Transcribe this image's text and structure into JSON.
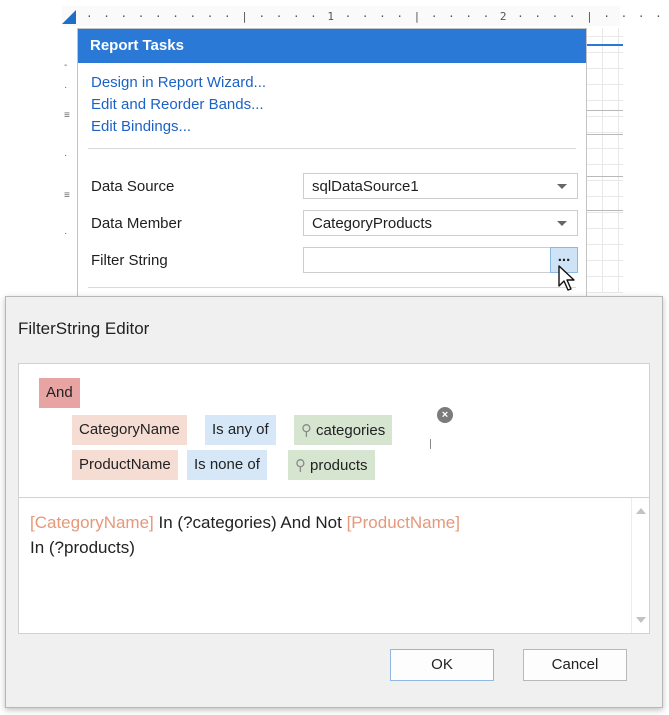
{
  "designer": {
    "ruler_ticks": "· · · · · · · · · | · · · · 1 · · · · | · · · · 2 · · · · | · · · ·",
    "vruler_marks": [
      "-",
      "·",
      "≡",
      "·",
      "≡",
      "·"
    ]
  },
  "report_tasks": {
    "title": "Report Tasks",
    "links": [
      "Design in Report Wizard...",
      "Edit and Reorder Bands...",
      "Edit Bindings..."
    ],
    "data_source": {
      "label": "Data Source",
      "value": "sqlDataSource1"
    },
    "data_member": {
      "label": "Data Member",
      "value": "CategoryProducts"
    },
    "filter_string": {
      "label": "Filter String",
      "value": "",
      "button": "..."
    }
  },
  "editor": {
    "title": "FilterString Editor",
    "group_operator": "And",
    "conditions": [
      {
        "field": "CategoryName",
        "operator": "Is any of",
        "parameter": "categories"
      },
      {
        "field": "ProductName",
        "operator": "Is none of",
        "parameter": "products"
      }
    ],
    "parameter_icon": "pin-icon",
    "remove_icon": "×",
    "expression": {
      "line1_field1": "[CategoryName]",
      "line1_mid": " In (?categories) And Not ",
      "line1_field2": "[ProductName]",
      "line2": "In (?products)"
    },
    "ok_label": "OK",
    "cancel_label": "Cancel"
  }
}
